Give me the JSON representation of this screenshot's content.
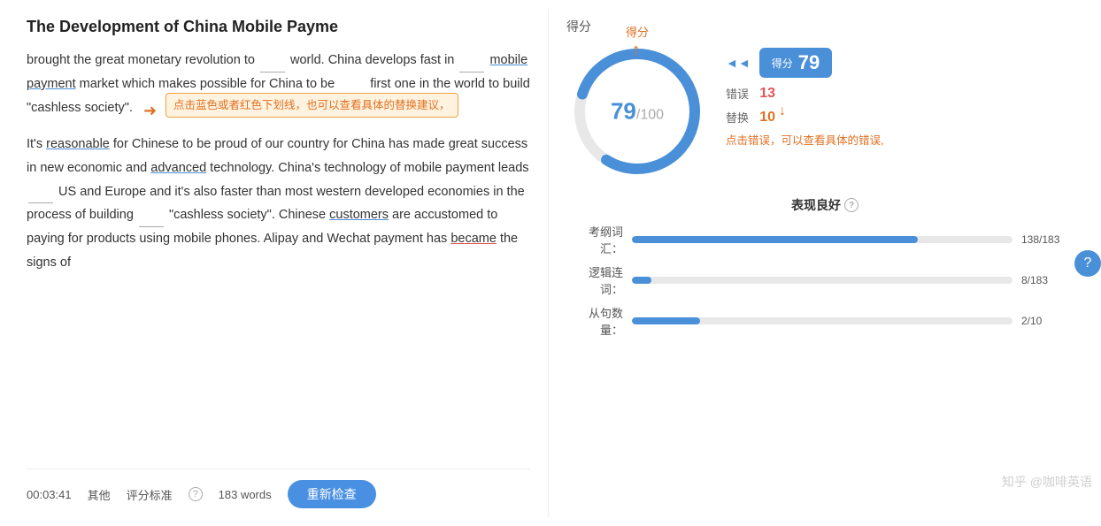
{
  "header": {
    "title": "The Development of China Mobile Payme"
  },
  "article": {
    "paragraphs": [
      "brought the great monetary revolution to __world. China develops fast in __mobile payment__ market which makes possible for China to be __first one in the world to build \"cashless society\".",
      "It's reasonable for Chinese to be proud of our country for China has made great success in new economic and advanced__ technology. China's technology of mobile payment leads __US and Europe and it's also faster than most western developed economies in the process of building __ \"cashless society\". Chinese customers__ are accustomed to paying for products using mobile phones. Alipay and Wechat payment has became__ the signs of"
    ],
    "tooltip_text": "点击蓝色或者红色下划线，也可以查看具体的替换建议，",
    "error_hint": "点击错误，可以查看具体的错误,"
  },
  "bottom_bar": {
    "time": "00:03:41",
    "category": "其他",
    "standard_label": "评分标准",
    "words": "183 words",
    "recheck_btn": "重新检查"
  },
  "score_panel": {
    "label_top": "得分",
    "circle_label": "得分",
    "score": "79",
    "total": "100",
    "score_display": "79/100",
    "score_card_label": "得分",
    "score_value": "79",
    "error_label": "错误",
    "error_value": "13",
    "replace_label": "替换",
    "replace_value": "10"
  },
  "performance": {
    "title": "表现良好",
    "rows": [
      {
        "label": "考纲词汇：",
        "fill_pct": 75,
        "count": "138/183"
      },
      {
        "label": "逻辑连词：",
        "fill_pct": 5,
        "count": "8/183"
      },
      {
        "label": "从句数量：",
        "fill_pct": 18,
        "count": "2/10"
      }
    ]
  },
  "watermark": "知乎 @咖啡英语",
  "icons": {
    "help": "?",
    "double_arrow": "◄◄",
    "arrow_up": "↑"
  }
}
